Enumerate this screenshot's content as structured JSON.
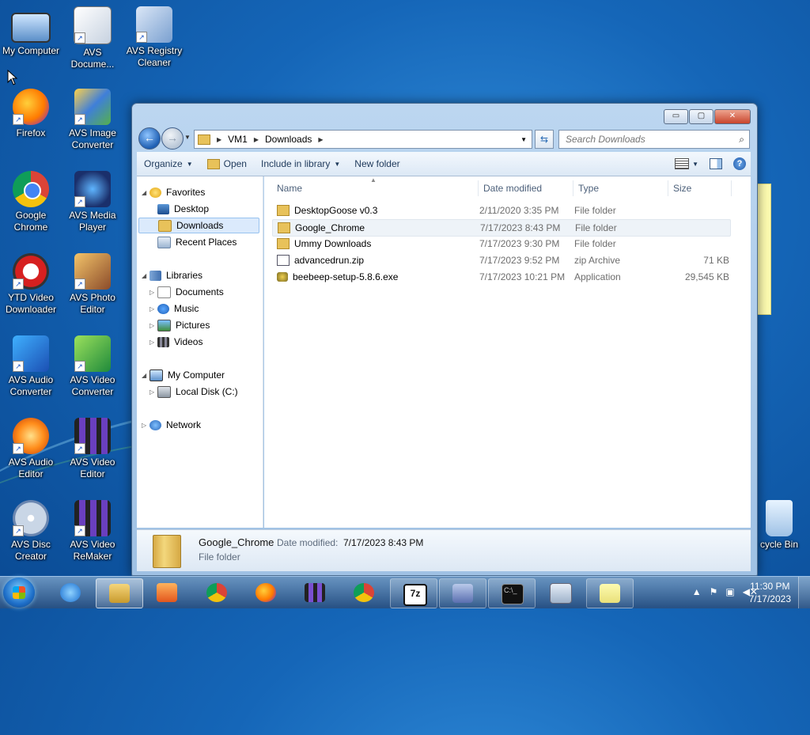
{
  "desktop": {
    "icons": [
      {
        "label": "My Computer",
        "icon": "computer-icon"
      },
      {
        "label": "AVS Docume...",
        "icon": "avs-document-icon"
      },
      {
        "label": "AVS Registry Cleaner",
        "icon": "avs-registry-icon"
      },
      {
        "label": "Firefox",
        "icon": "firefox-icon"
      },
      {
        "label": "AVS Image Converter",
        "icon": "avs-image-icon"
      },
      {
        "label": "Google Chrome",
        "icon": "chrome-icon"
      },
      {
        "label": "AVS Media Player",
        "icon": "avs-media-icon"
      },
      {
        "label": "YTD Video Downloader",
        "icon": "ytd-icon"
      },
      {
        "label": "AVS Photo Editor",
        "icon": "avs-photo-icon"
      },
      {
        "label": "AVS Audio Converter",
        "icon": "avs-audio-converter-icon"
      },
      {
        "label": "AVS Video Converter",
        "icon": "avs-video-converter-icon"
      },
      {
        "label": "AVS Audio Editor",
        "icon": "avs-audio-editor-icon"
      },
      {
        "label": "AVS Video Editor",
        "icon": "avs-video-editor-icon"
      },
      {
        "label": "AVS Disc Creator",
        "icon": "avs-disc-icon"
      },
      {
        "label": "AVS Video ReMaker",
        "icon": "avs-remaker-icon"
      },
      {
        "label": "cycle Bin",
        "icon": "recycle-bin-icon"
      }
    ]
  },
  "window": {
    "controls": {
      "minimize": "▭",
      "maximize": "▢",
      "close": "✕"
    },
    "address": {
      "segments": [
        "VM1",
        "Downloads"
      ]
    },
    "search": {
      "placeholder": "Search Downloads"
    },
    "toolbar": {
      "organize": "Organize",
      "open": "Open",
      "include_in_library": "Include in library",
      "new_folder": "New folder"
    },
    "nav": {
      "favorites": "Favorites",
      "desktop": "Desktop",
      "downloads": "Downloads",
      "recent_places": "Recent Places",
      "libraries": "Libraries",
      "documents": "Documents",
      "music": "Music",
      "pictures": "Pictures",
      "videos": "Videos",
      "my_computer": "My Computer",
      "local_disk": "Local Disk (C:)",
      "network": "Network"
    },
    "columns": {
      "name": "Name",
      "date": "Date modified",
      "type": "Type",
      "size": "Size"
    },
    "files": [
      {
        "name": "DesktopGoose v0.3",
        "date": "2/11/2020 3:35 PM",
        "type": "File folder",
        "size": "",
        "icon": "folder-icon"
      },
      {
        "name": "Google_Chrome",
        "date": "7/17/2023 8:43 PM",
        "type": "File folder",
        "size": "",
        "icon": "folder-icon"
      },
      {
        "name": "Ummy Downloads",
        "date": "7/17/2023 9:30 PM",
        "type": "File folder",
        "size": "",
        "icon": "folder-icon"
      },
      {
        "name": "advancedrun.zip",
        "date": "7/17/2023 9:52 PM",
        "type": "zip Archive",
        "size": "71 KB",
        "icon": "zip-icon"
      },
      {
        "name": "beebeep-setup-5.8.6.exe",
        "date": "7/17/2023 10:21 PM",
        "type": "Application",
        "size": "29,545 KB",
        "icon": "exe-icon"
      }
    ],
    "details": {
      "name": "Google_Chrome",
      "date_label": "Date modified:",
      "date": "7/17/2023 8:43 PM",
      "type": "File folder"
    }
  },
  "taskbar": {
    "seven_zip": "7z",
    "clock": {
      "time": "11:30 PM",
      "date": "7/17/2023"
    }
  }
}
